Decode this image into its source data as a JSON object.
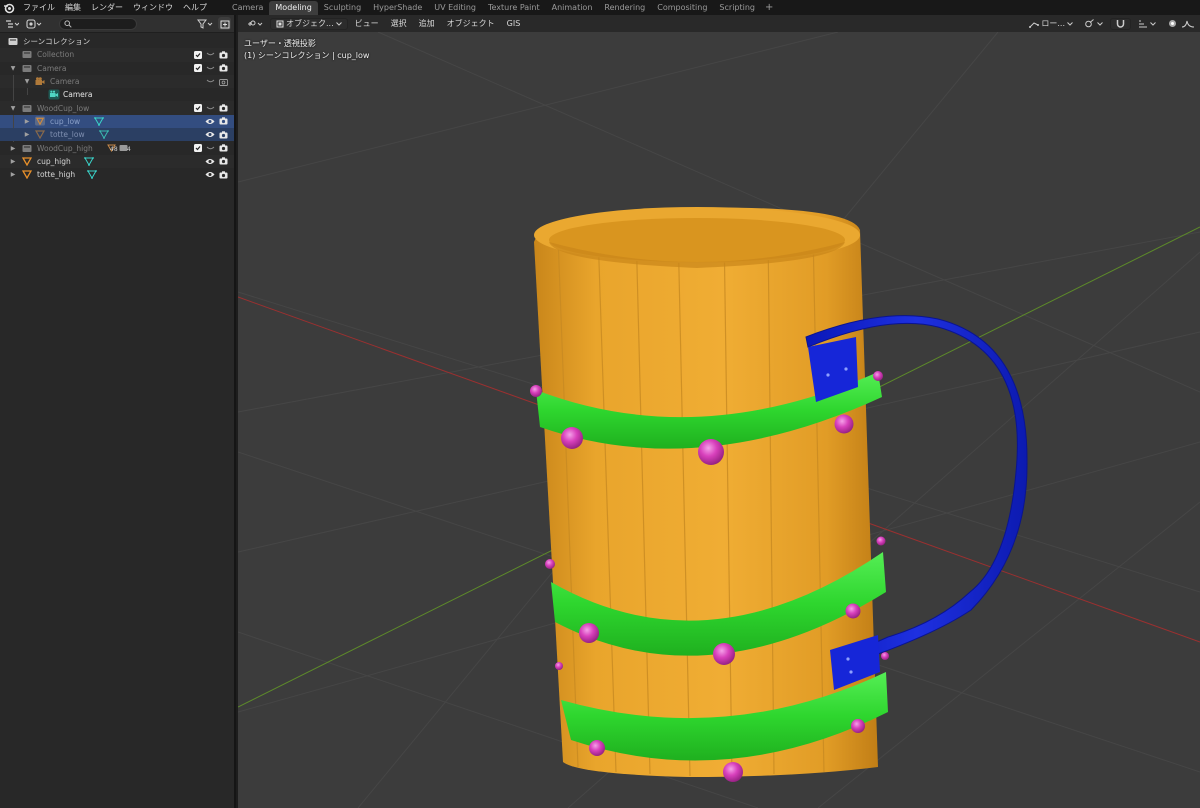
{
  "topbar": {
    "menus": [
      "ファイル",
      "編集",
      "レンダー",
      "ウィンドウ",
      "ヘルプ"
    ],
    "workspaces": [
      "Camera",
      "Modeling",
      "Sculpting",
      "HyperShade",
      "UV Editing",
      "Texture Paint",
      "Animation",
      "Rendering",
      "Compositing",
      "Scripting"
    ],
    "active_workspace": "Modeling",
    "add_symbol": "+"
  },
  "outliner": {
    "search_placeholder": "",
    "root_label": "シーンコレクション",
    "rows": [
      {
        "label": "Collection"
      },
      {
        "label": "Camera"
      },
      {
        "label": "Camera"
      },
      {
        "label": "Camera"
      },
      {
        "label": "WoodCup_low"
      },
      {
        "label": "cup_low"
      },
      {
        "label": "totte_low"
      },
      {
        "label": "WoodCup_high",
        "badge1": "48",
        "badge2": "4"
      },
      {
        "label": "cup_high"
      },
      {
        "label": "totte_high"
      }
    ]
  },
  "viewport": {
    "mode_label": "オブジェク...",
    "menus": [
      "ビュー",
      "選択",
      "追加",
      "オブジェクト",
      "GIS"
    ],
    "transform_orientation": "ロー...",
    "overlay_line1": "ユーザー・透視投影",
    "overlay_line2": "(1) シーンコレクション | cup_low"
  },
  "colors": {
    "wood": "#E8A22A",
    "bands": "#2FD82F",
    "rivets": "#D43CB4",
    "handle": "#1020D0",
    "x_axis": "#9b3030",
    "y_axis": "#5d8a2a",
    "grid": "#464646"
  }
}
